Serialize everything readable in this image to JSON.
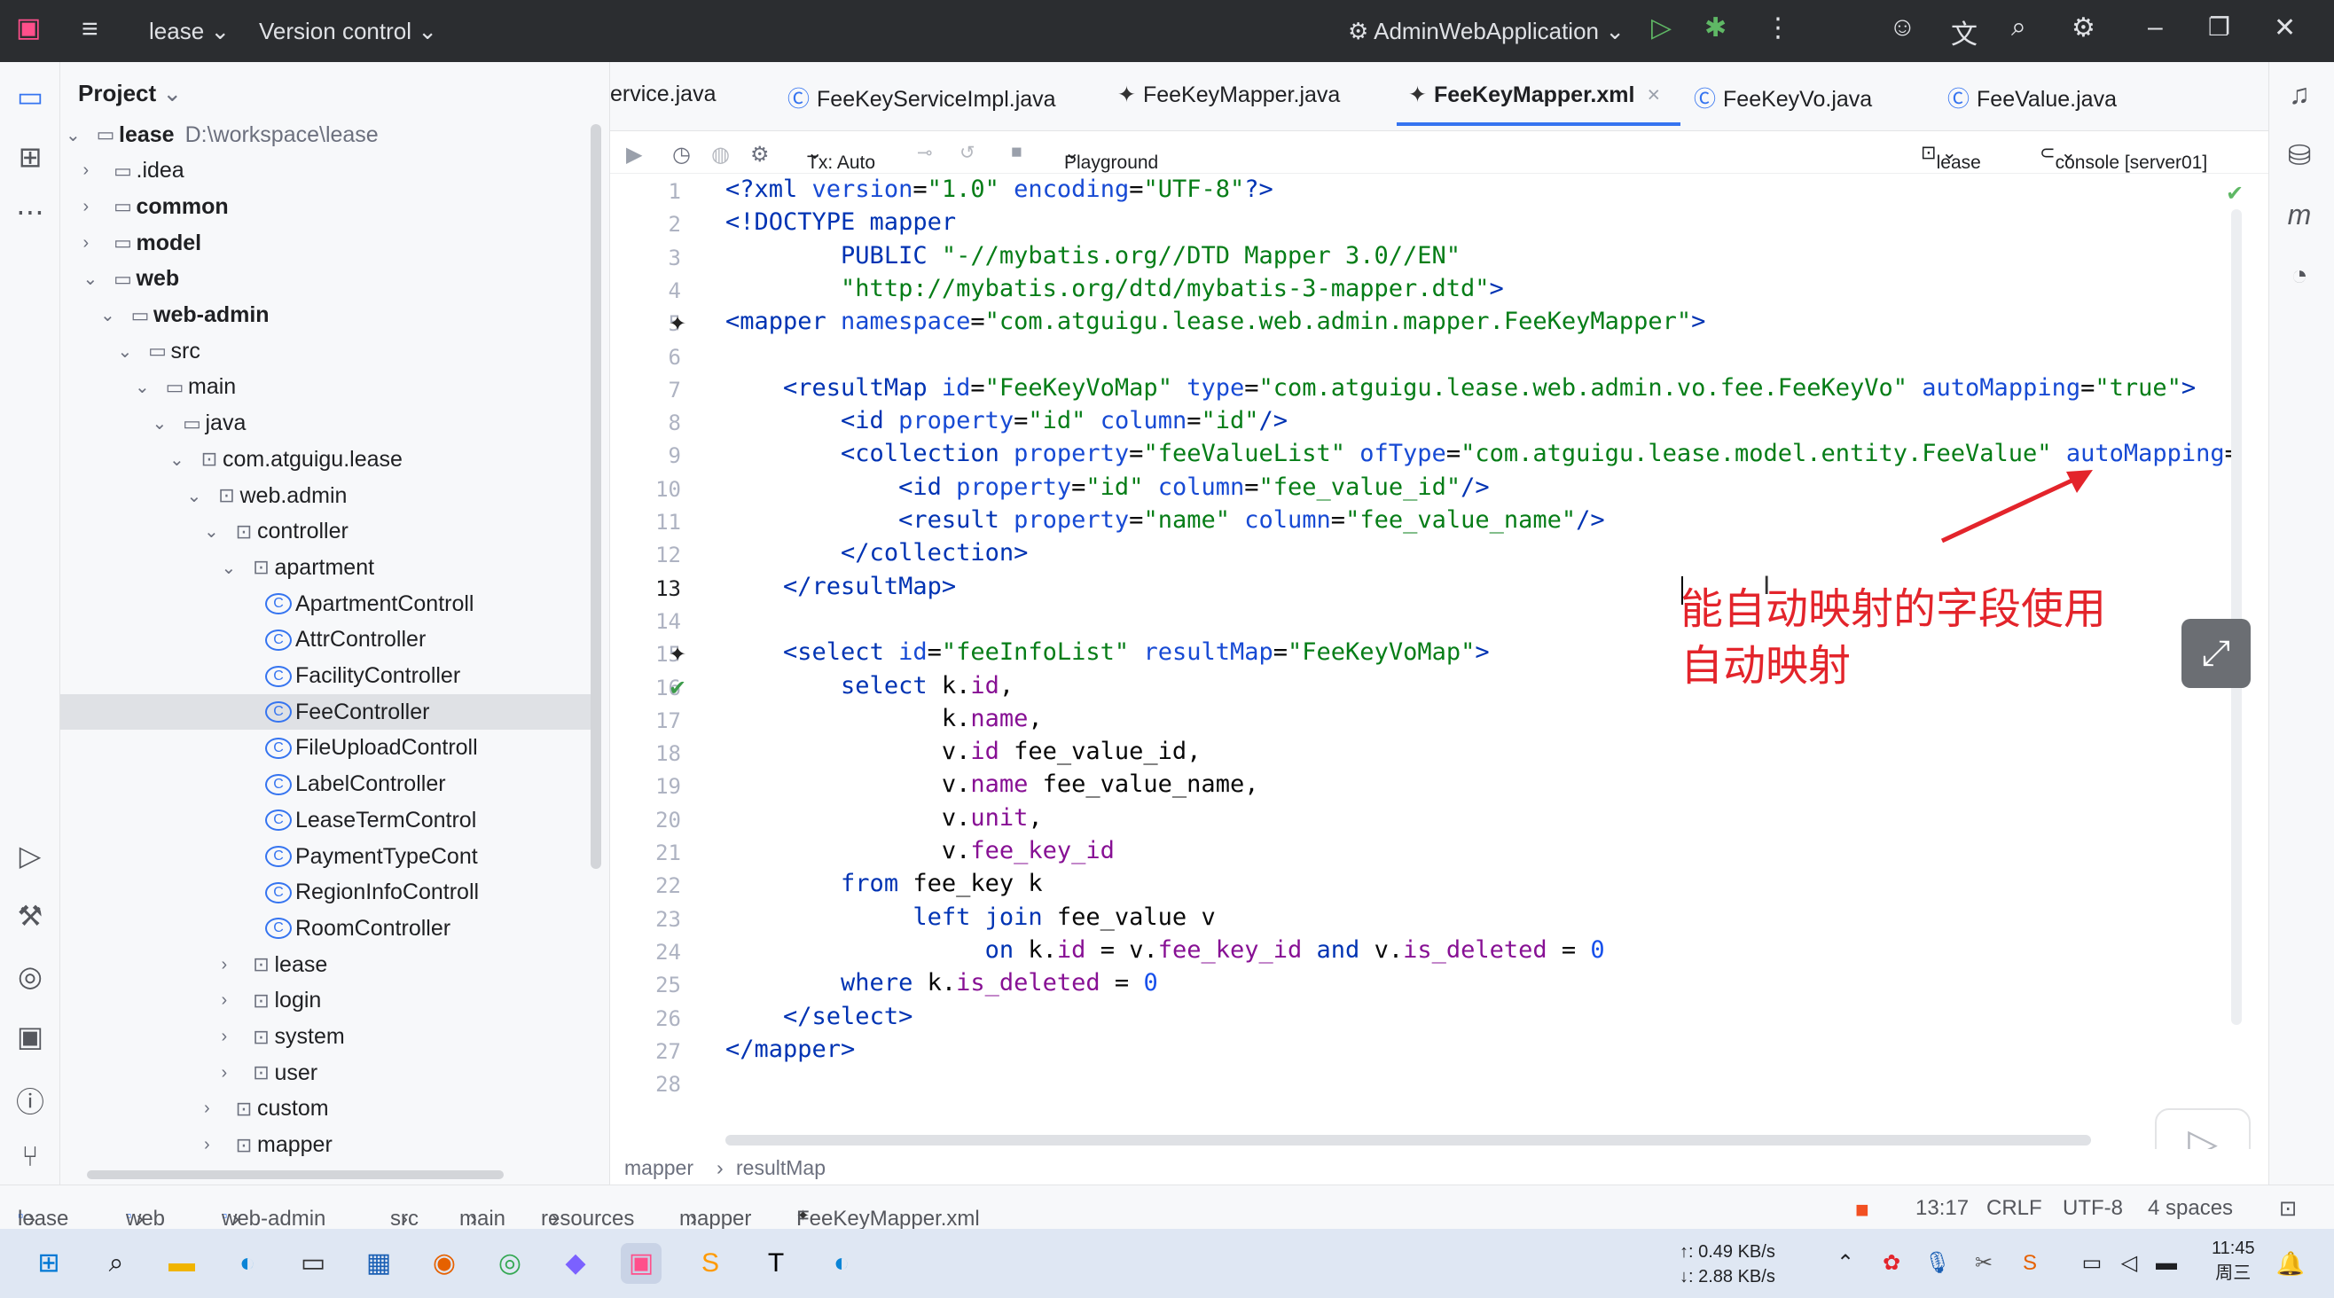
{
  "titlebar": {
    "project": "lease",
    "vcs": "Version control",
    "run_config": "AdminWebApplication"
  },
  "project_panel": {
    "title": "Project",
    "tree": [
      {
        "label": "lease",
        "path": "D:\\workspace\\lease",
        "depth": 0,
        "type": "module",
        "expanded": true,
        "bold": true
      },
      {
        "label": ".idea",
        "depth": 1,
        "type": "folder"
      },
      {
        "label": "common",
        "depth": 1,
        "type": "module",
        "bold": true
      },
      {
        "label": "model",
        "depth": 1,
        "type": "module",
        "bold": true
      },
      {
        "label": "web",
        "depth": 1,
        "type": "module",
        "bold": true,
        "expanded": true
      },
      {
        "label": "web-admin",
        "depth": 2,
        "type": "module",
        "bold": true,
        "expanded": true
      },
      {
        "label": "src",
        "depth": 3,
        "type": "folder",
        "expanded": true
      },
      {
        "label": "main",
        "depth": 4,
        "type": "folder",
        "expanded": true
      },
      {
        "label": "java",
        "depth": 5,
        "type": "folder",
        "expanded": true
      },
      {
        "label": "com.atguigu.lease",
        "depth": 6,
        "type": "package",
        "expanded": true
      },
      {
        "label": "web.admin",
        "depth": 7,
        "type": "package",
        "expanded": true
      },
      {
        "label": "controller",
        "depth": 8,
        "type": "package",
        "expanded": true
      },
      {
        "label": "apartment",
        "depth": 9,
        "type": "package",
        "expanded": true
      },
      {
        "label": "ApartmentControll",
        "depth": 10,
        "type": "class"
      },
      {
        "label": "AttrController",
        "depth": 10,
        "type": "class"
      },
      {
        "label": "FacilityController",
        "depth": 10,
        "type": "class"
      },
      {
        "label": "FeeController",
        "depth": 10,
        "type": "class",
        "selected": true
      },
      {
        "label": "FileUploadControll",
        "depth": 10,
        "type": "class"
      },
      {
        "label": "LabelController",
        "depth": 10,
        "type": "class"
      },
      {
        "label": "LeaseTermControl",
        "depth": 10,
        "type": "class"
      },
      {
        "label": "PaymentTypeCont",
        "depth": 10,
        "type": "class"
      },
      {
        "label": "RegionInfoControll",
        "depth": 10,
        "type": "class"
      },
      {
        "label": "RoomController",
        "depth": 10,
        "type": "class"
      },
      {
        "label": "lease",
        "depth": 9,
        "type": "package"
      },
      {
        "label": "login",
        "depth": 9,
        "type": "package"
      },
      {
        "label": "system",
        "depth": 9,
        "type": "package"
      },
      {
        "label": "user",
        "depth": 9,
        "type": "package"
      },
      {
        "label": "custom",
        "depth": 8,
        "type": "package"
      },
      {
        "label": "mapper",
        "depth": 8,
        "type": "package"
      }
    ]
  },
  "tabs": [
    {
      "label": "ervice.java",
      "icon": "class-icon"
    },
    {
      "label": "FeeKeyServiceImpl.java",
      "icon": "class-icon"
    },
    {
      "label": "FeeKeyMapper.java",
      "icon": "mybatis-icon"
    },
    {
      "label": "FeeKeyMapper.xml",
      "icon": "mybatis-icon",
      "active": true
    },
    {
      "label": "FeeKeyVo.java",
      "icon": "class-icon"
    },
    {
      "label": "FeeValue.java",
      "icon": "class-icon"
    }
  ],
  "editor_toolbar": {
    "tx": "Tx: Auto",
    "playground": "Playground",
    "schema": "lease",
    "console": "console [server01]"
  },
  "code_lines": [
    [
      [
        "tg",
        "<?xml "
      ],
      [
        "at",
        "version"
      ],
      [
        "p",
        "="
      ],
      [
        "vl",
        "\"1.0\""
      ],
      [
        "p",
        " "
      ],
      [
        "at",
        "encoding"
      ],
      [
        "p",
        "="
      ],
      [
        "vl",
        "\"UTF-8\""
      ],
      [
        "tg",
        "?>"
      ]
    ],
    [
      [
        "tg",
        "<!DOCTYPE mapper"
      ]
    ],
    [
      [
        "p",
        "        "
      ],
      [
        "tg",
        "PUBLIC "
      ],
      [
        "vl",
        "\"-//mybatis.org//DTD Mapper 3.0//EN\""
      ]
    ],
    [
      [
        "p",
        "        "
      ],
      [
        "vl",
        "\"http://mybatis.org/dtd/mybatis-3-mapper.dtd\""
      ],
      [
        "tg",
        ">"
      ]
    ],
    [
      [
        "tg",
        "<mapper "
      ],
      [
        "at",
        "namespace"
      ],
      [
        "p",
        "="
      ],
      [
        "vl",
        "\"com.atguigu.lease.web.admin.mapper.FeeKeyMapper\""
      ],
      [
        "tg",
        ">"
      ]
    ],
    [],
    [
      [
        "p",
        "    "
      ],
      [
        "tg",
        "<resultMap "
      ],
      [
        "at",
        "id"
      ],
      [
        "p",
        "="
      ],
      [
        "vl",
        "\"FeeKeyVoMap\""
      ],
      [
        "p",
        " "
      ],
      [
        "at",
        "type"
      ],
      [
        "p",
        "="
      ],
      [
        "vl",
        "\"com.atguigu.lease.web.admin.vo.fee.FeeKeyVo\""
      ],
      [
        "p",
        " "
      ],
      [
        "at",
        "autoMapping"
      ],
      [
        "p",
        "="
      ],
      [
        "vl",
        "\"true\""
      ],
      [
        "tg",
        ">"
      ]
    ],
    [
      [
        "p",
        "        "
      ],
      [
        "tg",
        "<id "
      ],
      [
        "at",
        "property"
      ],
      [
        "p",
        "="
      ],
      [
        "vl",
        "\"id\""
      ],
      [
        "p",
        " "
      ],
      [
        "at",
        "column"
      ],
      [
        "p",
        "="
      ],
      [
        "vl",
        "\"id\""
      ],
      [
        "tg",
        "/>"
      ]
    ],
    [
      [
        "p",
        "        "
      ],
      [
        "tg",
        "<collection "
      ],
      [
        "at",
        "property"
      ],
      [
        "p",
        "="
      ],
      [
        "vl",
        "\"feeValueList\""
      ],
      [
        "p",
        " "
      ],
      [
        "at",
        "ofType"
      ],
      [
        "p",
        "="
      ],
      [
        "vl",
        "\"com.atguigu.lease.model.entity.FeeValue\""
      ],
      [
        "p",
        " "
      ],
      [
        "at",
        "autoMapping"
      ],
      [
        "p",
        "="
      ],
      [
        "vl",
        "'"
      ]
    ],
    [
      [
        "p",
        "            "
      ],
      [
        "tg",
        "<id "
      ],
      [
        "at",
        "property"
      ],
      [
        "p",
        "="
      ],
      [
        "vl",
        "\"id\""
      ],
      [
        "p",
        " "
      ],
      [
        "at",
        "column"
      ],
      [
        "p",
        "="
      ],
      [
        "vl",
        "\"fee_value_id\""
      ],
      [
        "tg",
        "/>"
      ]
    ],
    [
      [
        "p",
        "            "
      ],
      [
        "tg",
        "<result "
      ],
      [
        "at",
        "property"
      ],
      [
        "p",
        "="
      ],
      [
        "vl",
        "\"name\""
      ],
      [
        "p",
        " "
      ],
      [
        "at",
        "column"
      ],
      [
        "p",
        "="
      ],
      [
        "vl",
        "\"fee_value_name\""
      ],
      [
        "tg",
        "/>"
      ]
    ],
    [
      [
        "p",
        "        "
      ],
      [
        "tg",
        "</collection>"
      ]
    ],
    [
      [
        "p",
        "    "
      ],
      [
        "tg",
        "</resultMap>"
      ]
    ],
    [],
    [
      [
        "p",
        "    "
      ],
      [
        "tg",
        "<select "
      ],
      [
        "at",
        "id"
      ],
      [
        "p",
        "="
      ],
      [
        "vl",
        "\"feeInfoList\""
      ],
      [
        "p",
        " "
      ],
      [
        "at",
        "resultMap"
      ],
      [
        "p",
        "="
      ],
      [
        "vl",
        "\"FeeKeyVoMap\""
      ],
      [
        "tg",
        ">"
      ]
    ],
    [
      [
        "p",
        "        "
      ],
      [
        "kw",
        "select "
      ],
      [
        "p",
        "k."
      ],
      [
        "fd",
        "id"
      ],
      [
        "p",
        ","
      ]
    ],
    [
      [
        "p",
        "               k."
      ],
      [
        "fd",
        "name"
      ],
      [
        "p",
        ","
      ]
    ],
    [
      [
        "p",
        "               v."
      ],
      [
        "fd",
        "id "
      ],
      [
        "p",
        "fee_value_id,"
      ]
    ],
    [
      [
        "p",
        "               v."
      ],
      [
        "fd",
        "name "
      ],
      [
        "p",
        "fee_value_name,"
      ]
    ],
    [
      [
        "p",
        "               v."
      ],
      [
        "fd",
        "unit"
      ],
      [
        "p",
        ","
      ]
    ],
    [
      [
        "p",
        "               v."
      ],
      [
        "fd",
        "fee_key_id"
      ]
    ],
    [
      [
        "p",
        "        "
      ],
      [
        "kw",
        "from "
      ],
      [
        "p",
        "fee_key k"
      ]
    ],
    [
      [
        "p",
        "             "
      ],
      [
        "kw",
        "left join "
      ],
      [
        "p",
        "fee_value v"
      ]
    ],
    [
      [
        "p",
        "                  "
      ],
      [
        "kw",
        "on "
      ],
      [
        "p",
        "k."
      ],
      [
        "fd",
        "id "
      ],
      [
        "p",
        "= v."
      ],
      [
        "fd",
        "fee_key_id "
      ],
      [
        "kw",
        "and "
      ],
      [
        "p",
        "v."
      ],
      [
        "fd",
        "is_deleted "
      ],
      [
        "p",
        "= "
      ],
      [
        "nm",
        "0"
      ]
    ],
    [
      [
        "p",
        "        "
      ],
      [
        "kw",
        "where "
      ],
      [
        "p",
        "k."
      ],
      [
        "fd",
        "is_deleted "
      ],
      [
        "p",
        "= "
      ],
      [
        "nm",
        "0"
      ]
    ],
    [
      [
        "p",
        "    "
      ],
      [
        "tg",
        "</select>"
      ]
    ],
    [
      [
        "tg",
        "</mapper>"
      ]
    ],
    []
  ],
  "annotation": {
    "line1": "能自动映射的字段使用",
    "line2": "自动映射"
  },
  "editor_breadcrumb": {
    "a": "mapper",
    "b": "resultMap"
  },
  "statusbar": {
    "path": [
      "lease",
      "web",
      "web-admin",
      "src",
      "main",
      "resources",
      "mapper",
      "FeeKeyMapper.xml"
    ],
    "position": "13:17",
    "line_sep": "CRLF",
    "encoding": "UTF-8",
    "indent": "4 spaces"
  },
  "taskbar": {
    "net_up": "↑: 0.49 KB/s",
    "net_down": "↓: 2.88 KB/s",
    "time": "11:45",
    "day": "周三"
  },
  "colors": {
    "accent": "#3574f0",
    "annotation": "#e3242b",
    "highlight": "#eef5ea"
  }
}
